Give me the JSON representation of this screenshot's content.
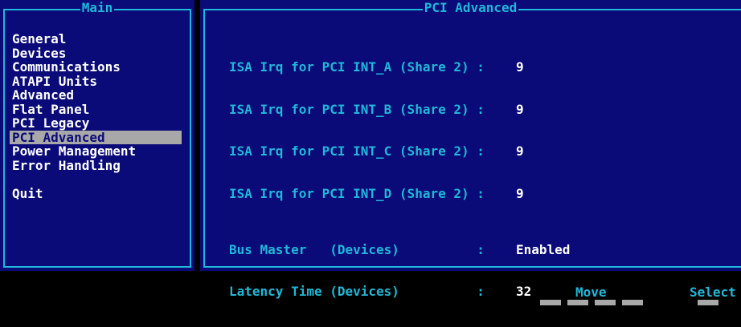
{
  "left_panel": {
    "title": "Main",
    "items": [
      {
        "label": "General"
      },
      {
        "label": "Devices"
      },
      {
        "label": "Communications"
      },
      {
        "label": "ATAPI Units"
      },
      {
        "label": "Advanced"
      },
      {
        "label": "Flat Panel"
      },
      {
        "label": "PCI Legacy"
      },
      {
        "label": "PCI Advanced",
        "selected": true
      },
      {
        "label": "Power Management"
      },
      {
        "label": "Error Handling"
      },
      {
        "label": "Quit"
      }
    ]
  },
  "right_panel": {
    "title": "PCI Advanced",
    "settings": [
      {
        "label": "ISA Irq for PCI INT_A (Share 2)",
        "sep": " : ",
        "value": "9"
      },
      {
        "label": "ISA Irq for PCI INT_B (Share 2)",
        "sep": " : ",
        "value": "9"
      },
      {
        "label": "ISA Irq for PCI INT_C (Share 2)",
        "sep": " : ",
        "value": "9"
      },
      {
        "label": "ISA Irq for PCI INT_D (Share 2)",
        "sep": " : ",
        "value": "9"
      },
      {
        "label": "Bus Master   (Devices)",
        "sep": "          : ",
        "value": "Enabled"
      },
      {
        "label": "Latency Time (Devices)",
        "sep": "          : ",
        "value": "32"
      }
    ]
  },
  "help_bar": {
    "move_label": "Move",
    "select_label": "Select"
  },
  "colors": {
    "panel_bg": "#0a0a78",
    "frame_cyan": "#1fb8d8",
    "highlight_gray": "#a8a8a8",
    "text_white": "#ffffff",
    "screen_bg": "#000000"
  }
}
